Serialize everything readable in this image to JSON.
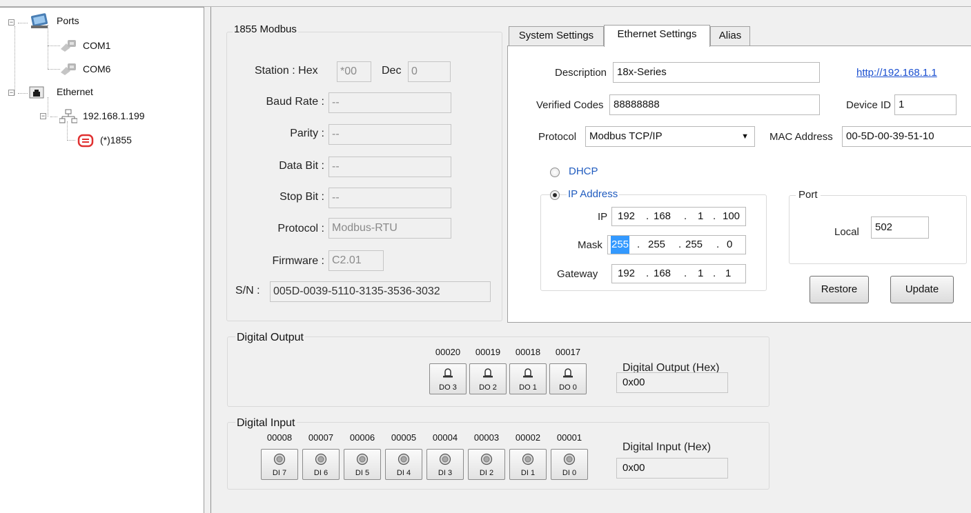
{
  "tree": {
    "ports_label": "Ports",
    "com1_label": "COM1",
    "com6_label": "COM6",
    "ethernet_label": "Ethernet",
    "ip_label": "192.168.1.199",
    "device_label": "(*)1855"
  },
  "module": {
    "group_title": "1855 Modbus",
    "station_label": "Station :  Hex",
    "station_hex": "*00",
    "dec_label": "Dec",
    "station_dec": "0",
    "baud_label": "Baud Rate :",
    "baud_value": "--",
    "parity_label": "Parity :",
    "parity_value": "--",
    "databit_label": "Data Bit :",
    "databit_value": "--",
    "stopbit_label": "Stop Bit :",
    "stopbit_value": "--",
    "protocol_label": "Protocol :",
    "protocol_value": "Modbus-RTU",
    "firmware_label": "Firmware :",
    "firmware_value": "C2.01",
    "sn_label": "S/N :",
    "sn_value": "005D-0039-5110-3135-3536-3032"
  },
  "tabs": {
    "system": "System Settings",
    "ethernet": "Ethernet Settings",
    "alias": "Alias"
  },
  "ethernet": {
    "description_label": "Description",
    "description_value": "18x-Series",
    "link": "http://192.168.1.1",
    "verified_label": "Verified Codes",
    "verified_value": "88888888",
    "device_id_label": "Device ID",
    "device_id_value": "1",
    "protocol_label": "Protocol",
    "protocol_value": "Modbus TCP/IP",
    "mac_label": "MAC Address",
    "mac_value": "00-5D-00-39-51-10",
    "dhcp_label": "DHCP",
    "ipaddr_label": "IP Address",
    "ip_label": "IP",
    "ip": [
      "192",
      "168",
      "1",
      "100"
    ],
    "mask_label": "Mask",
    "mask": [
      "255",
      "255",
      "255",
      "0"
    ],
    "gateway_label": "Gateway",
    "gateway": [
      "192",
      "168",
      "1",
      "1"
    ],
    "port_group": "Port",
    "local_label": "Local",
    "local_value": "502",
    "restore_label": "Restore",
    "update_label": "Update"
  },
  "digital_output": {
    "title": "Digital Output",
    "addresses": [
      "00020",
      "00019",
      "00018",
      "00017"
    ],
    "buttons": [
      "DO 3",
      "DO 2",
      "DO 1",
      "DO 0"
    ],
    "hex_label": "Digital Output (Hex)",
    "hex_value": "0x00"
  },
  "digital_input": {
    "title": "Digital Input",
    "addresses": [
      "00008",
      "00007",
      "00006",
      "00005",
      "00004",
      "00003",
      "00002",
      "00001"
    ],
    "buttons": [
      "DI 7",
      "DI 6",
      "DI 5",
      "DI 4",
      "DI 3",
      "DI 2",
      "DI 1",
      "DI 0"
    ],
    "hex_label": "Digital Input (Hex)",
    "hex_value": "0x00"
  }
}
